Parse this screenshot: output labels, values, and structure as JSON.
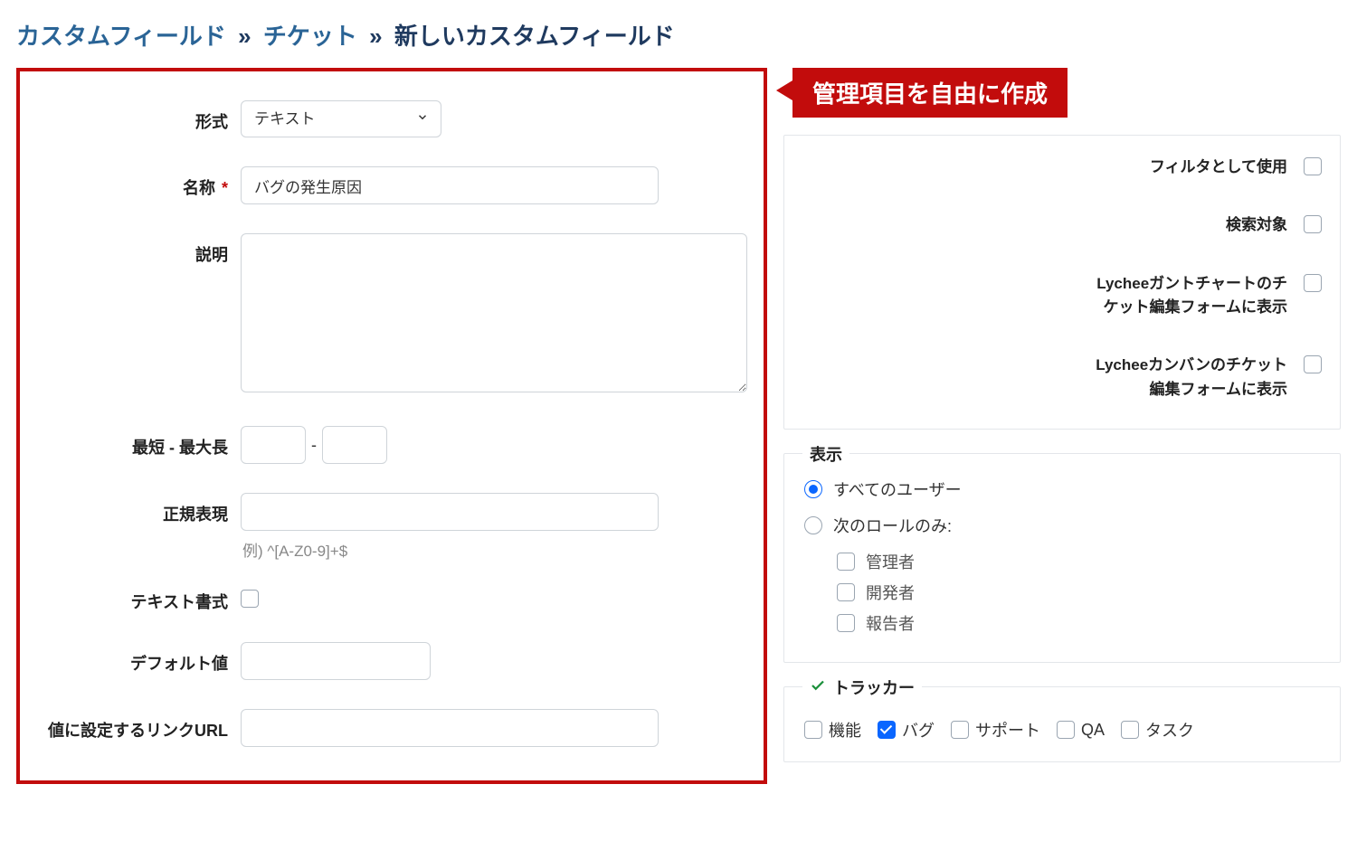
{
  "breadcrumb": {
    "custom_fields": "カスタムフィールド",
    "tickets": "チケット",
    "current": "新しいカスタムフィールド",
    "sep": "»"
  },
  "annotation": "管理項目を自由に作成",
  "form": {
    "format_label": "形式",
    "format_value": "テキスト",
    "name_label": "名称",
    "name_value": "バグの発生原因",
    "description_label": "説明",
    "description_value": "",
    "length_label": "最短 - 最大長",
    "length_sep": "-",
    "min_length": "",
    "max_length": "",
    "regex_label": "正規表現",
    "regex_value": "",
    "regex_hint": "例) ^[A-Z0-9]+$",
    "text_format_label": "テキスト書式",
    "default_label": "デフォルト値",
    "default_value": "",
    "url_label": "値に設定するリンクURL",
    "url_value": ""
  },
  "options": {
    "filter": "フィルタとして使用",
    "searchable": "検索対象",
    "gantt_form": "Lycheeガントチャートのチケット編集フォームに表示",
    "kanban_form": "Lycheeカンバンのチケット編集フォームに表示"
  },
  "visibility": {
    "legend": "表示",
    "all_users": "すべてのユーザー",
    "roles_only": "次のロールのみ:",
    "roles": {
      "admin": "管理者",
      "developer": "開発者",
      "reporter": "報告者"
    }
  },
  "trackers": {
    "legend": "トラッカー",
    "items": [
      {
        "label": "機能",
        "checked": false
      },
      {
        "label": "バグ",
        "checked": true
      },
      {
        "label": "サポート",
        "checked": false
      },
      {
        "label": "QA",
        "checked": false
      },
      {
        "label": "タスク",
        "checked": false
      }
    ]
  }
}
